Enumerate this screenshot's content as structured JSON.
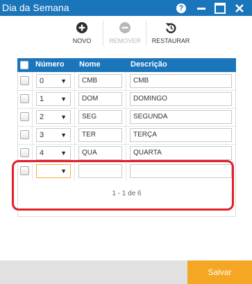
{
  "window": {
    "title": "Dia da Semana",
    "help_label": "?"
  },
  "toolbar": {
    "novo": "NOVO",
    "remover": "REMOVER",
    "restaurar": "RESTAURAR"
  },
  "grid": {
    "columns": {
      "numero": "Número",
      "nome": "Nome",
      "descricao": "Descrição"
    },
    "rows": [
      {
        "numero": "0",
        "nome": "CMB",
        "descricao": "CMB"
      },
      {
        "numero": "1",
        "nome": "DOM",
        "descricao": "DOMINGO"
      },
      {
        "numero": "2",
        "nome": "SEG",
        "descricao": "SEGUNDA"
      },
      {
        "numero": "3",
        "nome": "TER",
        "descricao": "TERÇA"
      },
      {
        "numero": "4",
        "nome": "QUA",
        "descricao": "QUARTA"
      }
    ],
    "new_row": {
      "numero": "",
      "nome": "",
      "descricao": ""
    },
    "pager_text": "1 - 1 de 6",
    "dropdown_arrow": "▼"
  },
  "footer": {
    "save_label": "Salvar"
  },
  "colors": {
    "accent": "#1b75bb",
    "save": "#f5a623",
    "highlight": "#e41f2a"
  },
  "icons": [
    "help-icon",
    "minimize-icon",
    "maximize-icon",
    "close-icon",
    "plus-circle-icon",
    "minus-circle-icon",
    "restore-icon",
    "dropdown-arrow-icon",
    "checkbox-icon"
  ]
}
